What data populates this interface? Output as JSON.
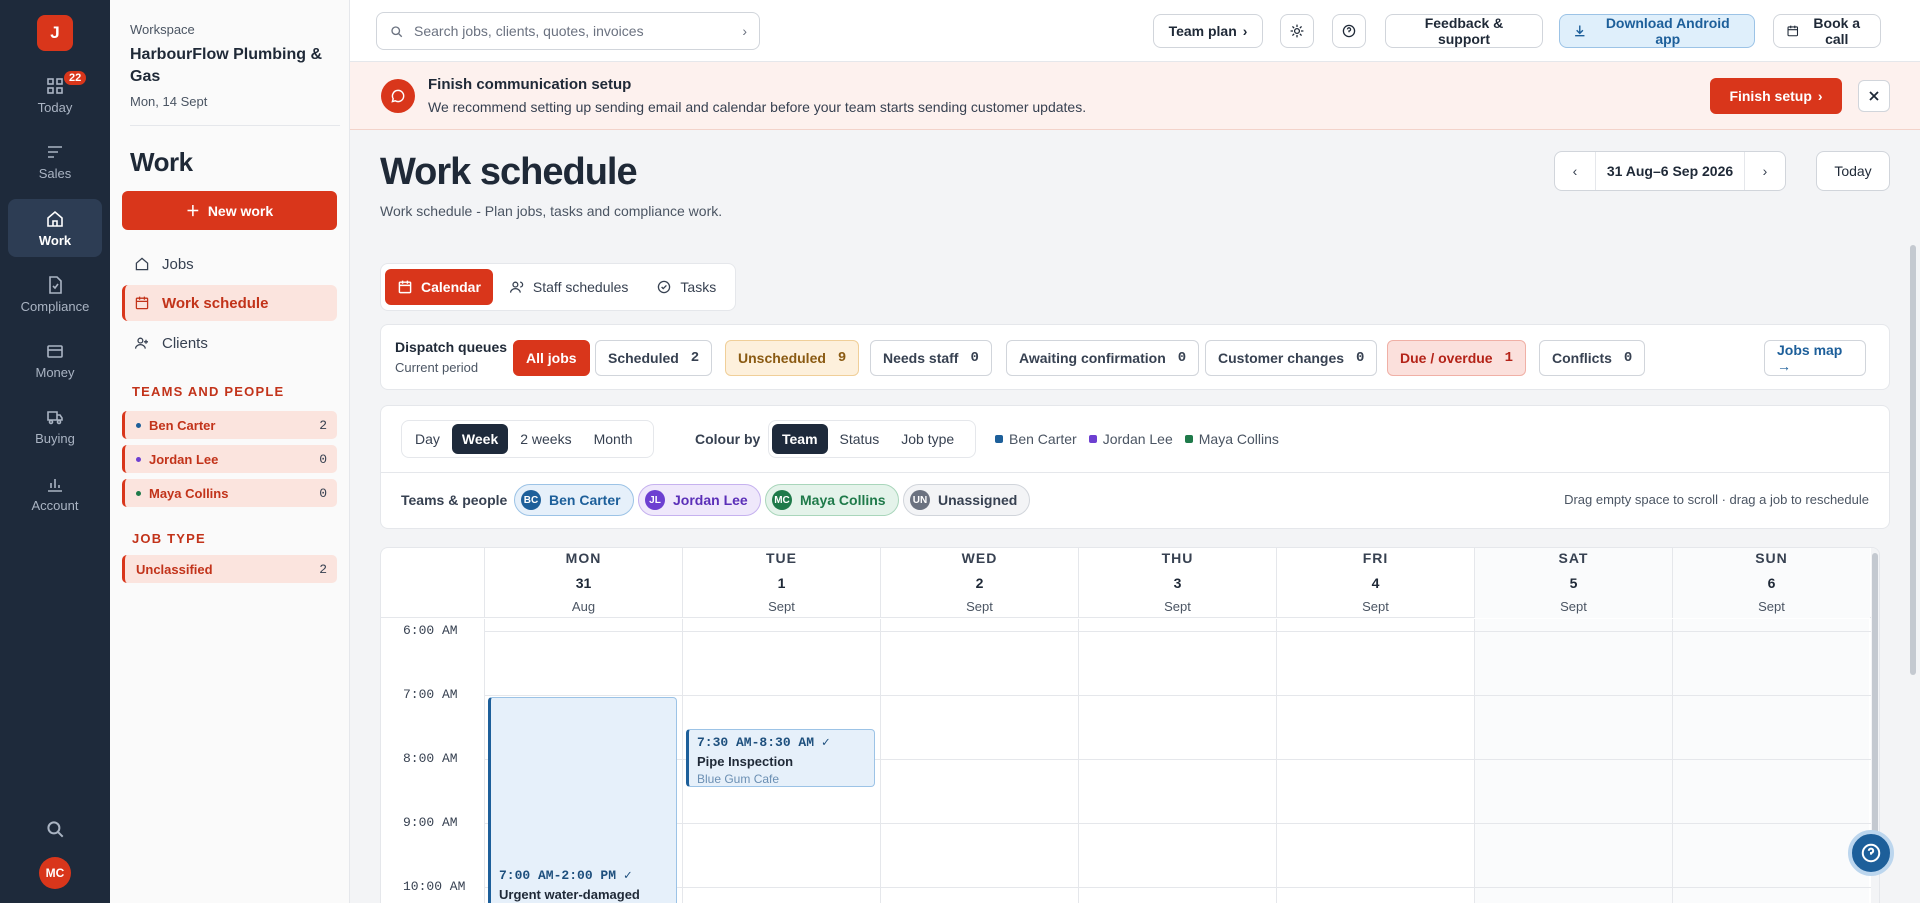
{
  "rail": {
    "logo": "J",
    "items": [
      {
        "label": "Today",
        "icon": "dashboard-icon",
        "badge": "22"
      },
      {
        "label": "Sales",
        "icon": "sales-icon"
      },
      {
        "label": "Work",
        "icon": "home-icon",
        "active": true
      },
      {
        "label": "Compliance",
        "icon": "document-icon"
      },
      {
        "label": "Money",
        "icon": "wallet-icon"
      },
      {
        "label": "Buying",
        "icon": "truck-icon"
      },
      {
        "label": "Account",
        "icon": "chart-icon"
      }
    ],
    "avatar": "MC"
  },
  "sidebar": {
    "workspace_label": "Workspace",
    "workspace_name": "HarbourFlow Plumbing & Gas",
    "date": "Mon, 14 Sept",
    "title": "Work",
    "new_work": "New work",
    "nav": [
      {
        "label": "Jobs",
        "icon": "home-icon"
      },
      {
        "label": "Work schedule",
        "icon": "calendar-icon",
        "active": true
      },
      {
        "label": "Clients",
        "icon": "add-person-icon"
      }
    ],
    "teams_title": "TEAMS AND PEOPLE",
    "teams": [
      {
        "name": "Ben Carter",
        "count": "2",
        "color": "#1d5f9a"
      },
      {
        "name": "Jordan Lee",
        "count": "0",
        "color": "#6d3fd1"
      },
      {
        "name": "Maya Collins",
        "count": "0",
        "color": "#1f7a4a"
      }
    ],
    "jobtype_title": "JOB TYPE",
    "jobtypes": [
      {
        "name": "Unclassified",
        "count": "2"
      }
    ]
  },
  "topbar": {
    "search_placeholder": "Search jobs, clients, quotes, invoices",
    "team_plan": "Team plan",
    "feedback": "Feedback & support",
    "android": "Download Android app",
    "book_call": "Book a call"
  },
  "banner": {
    "title": "Finish communication setup",
    "text": "We recommend setting up sending email and calendar before your team starts sending customer updates.",
    "button": "Finish setup"
  },
  "main": {
    "title": "Work schedule",
    "subtitle": "Work schedule - Plan jobs, tasks and compliance work.",
    "date_range": "31 Aug–6 Sep 2026",
    "today": "Today",
    "view_tabs": [
      "Calendar",
      "Staff schedules",
      "Tasks"
    ],
    "queues": {
      "label": "Dispatch queues",
      "sub": "Current period",
      "all": "All jobs",
      "items": [
        {
          "label": "Scheduled",
          "count": "2"
        },
        {
          "label": "Unscheduled",
          "count": "9"
        },
        {
          "label": "Needs staff",
          "count": "0"
        },
        {
          "label": "Awaiting confirmation",
          "count": "0"
        },
        {
          "label": "Customer changes",
          "count": "0"
        },
        {
          "label": "Due / overdue",
          "count": "1"
        },
        {
          "label": "Conflicts",
          "count": "0"
        }
      ],
      "map": "Jobs map →"
    },
    "controls": {
      "ranges": [
        "Day",
        "Week",
        "2 weeks",
        "Month"
      ],
      "colour_by_label": "Colour by",
      "colour_by": [
        "Team",
        "Status",
        "Job type"
      ],
      "legend": [
        {
          "name": "Ben Carter",
          "color": "#1d5f9a"
        },
        {
          "name": "Jordan Lee",
          "color": "#6d3fd1"
        },
        {
          "name": "Maya Collins",
          "color": "#1f7a4a"
        }
      ],
      "people_label": "Teams & people",
      "people": [
        {
          "initials": "BC",
          "name": "Ben Carter"
        },
        {
          "initials": "JL",
          "name": "Jordan Lee"
        },
        {
          "initials": "MC",
          "name": "Maya Collins"
        },
        {
          "initials": "UN",
          "name": "Unassigned"
        }
      ],
      "hint": "Drag empty space to scroll · drag a job to reschedule"
    },
    "calendar": {
      "days": [
        {
          "name": "MON",
          "date": "31",
          "month": "Aug"
        },
        {
          "name": "TUE",
          "date": "1",
          "month": "Sept"
        },
        {
          "name": "WED",
          "date": "2",
          "month": "Sept"
        },
        {
          "name": "THU",
          "date": "3",
          "month": "Sept"
        },
        {
          "name": "FRI",
          "date": "4",
          "month": "Sept"
        },
        {
          "name": "SAT",
          "date": "5",
          "month": "Sept"
        },
        {
          "name": "SUN",
          "date": "6",
          "month": "Sept"
        }
      ],
      "times": [
        "6:00 AM",
        "7:00 AM",
        "8:00 AM",
        "9:00 AM",
        "10:00 AM"
      ],
      "events": [
        {
          "time": "7:00 AM-2:00 PM ✓",
          "title": "Urgent water-damaged",
          "client": ""
        },
        {
          "time": "7:30 AM-8:30 AM ✓",
          "title": "Pipe Inspection",
          "client": "Blue Gum Cafe"
        }
      ]
    }
  }
}
